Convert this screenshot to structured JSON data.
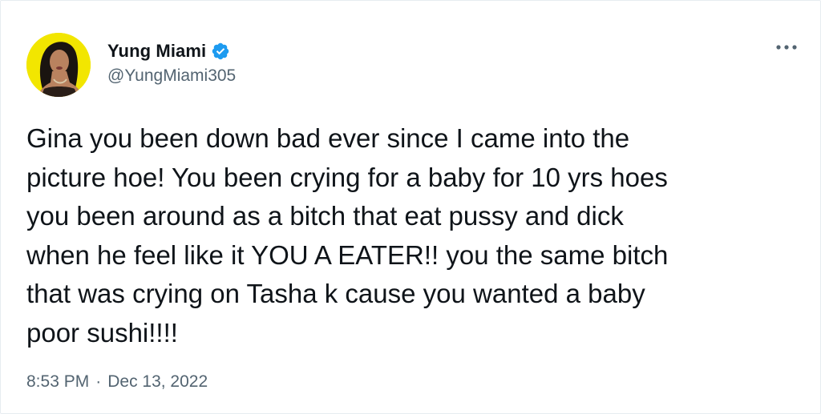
{
  "author": {
    "display_name": "Yung Miami",
    "handle": "@YungMiami305",
    "verified": true,
    "avatar_bg": "#f2e600"
  },
  "tweet": {
    "text": "Gina you been down bad ever since I came into the\npicture hoe! You been crying for a baby for 10 yrs hoes\nyou been around as a bitch that eat pussy and dick\nwhen he feel like it YOU A EATER!! you the same bitch\nthat was crying on Tasha k cause you wanted a baby\npoor sushi!!!!",
    "time": "8:53 PM",
    "separator": "·",
    "date": "Dec 13, 2022"
  },
  "icons": {
    "verified": "verified-badge-icon",
    "more": "more-options-icon"
  },
  "colors": {
    "verified_blue": "#1d9bf0",
    "secondary_text": "#536471",
    "primary_text": "#0f1419"
  }
}
